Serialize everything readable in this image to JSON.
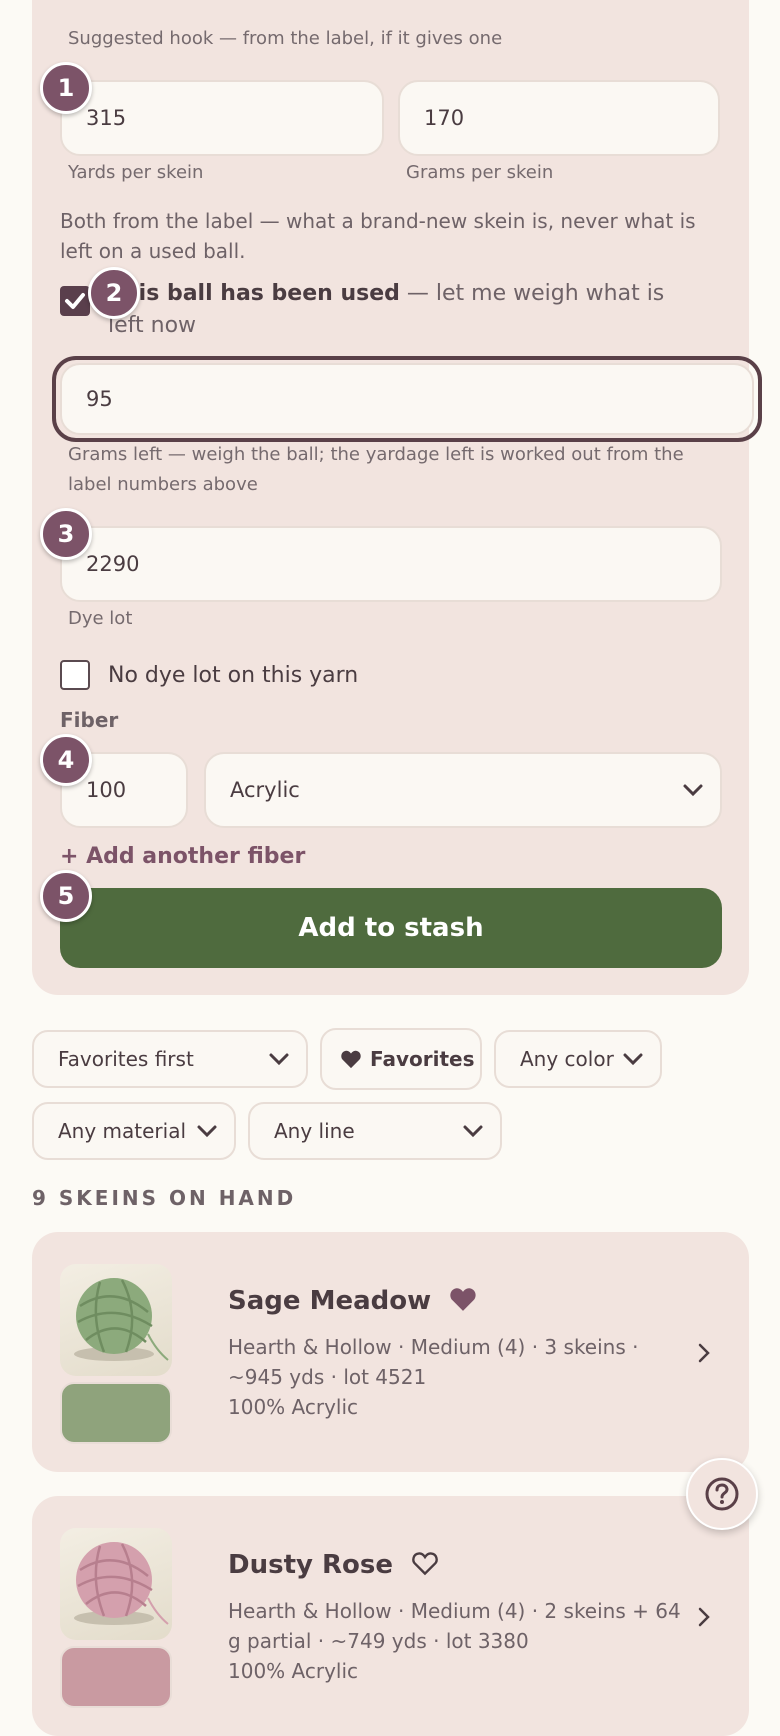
{
  "form": {
    "hook_help": "Suggested hook — from the label, if it gives one",
    "yards": {
      "value": "315",
      "label": "Yards per skein"
    },
    "grams": {
      "value": "170",
      "label": "Grams per skein"
    },
    "label_note": "Both from the label — what a brand-new skein is, never what is left on a used ball.",
    "used_checkbox": {
      "checked": true,
      "label_bold": "This ball has been used",
      "label_rest": " — let me weigh what is left now"
    },
    "grams_left": {
      "value": "95",
      "help": "Grams left — weigh the ball; the yardage left is worked out from the label numbers above"
    },
    "dye_lot": {
      "value": "2290",
      "label": "Dye lot"
    },
    "no_dye_lot": {
      "checked": false,
      "label": "No dye lot on this yarn"
    },
    "fiber": {
      "heading": "Fiber",
      "percent": "100",
      "material": "Acrylic",
      "add_label": "+ Add another fiber"
    },
    "submit_label": "Add to stash"
  },
  "badges": [
    "1",
    "2",
    "3",
    "4",
    "5"
  ],
  "filters": {
    "sort": "Favorites first",
    "favorites": "Favorites",
    "color": "Any color",
    "material": "Any material",
    "line": "Any line"
  },
  "list_heading": "9 SKEINS ON HAND",
  "yarns": [
    {
      "name": "Sage Meadow",
      "favorite": true,
      "meta": "Hearth & Hollow · Medium (4) · 3 skeins · ~945 yds · lot 4521",
      "fiber": "100% Acrylic",
      "swatch_color": "#8fa37c",
      "ball_color": "#8caa7c"
    },
    {
      "name": "Dusty Rose",
      "favorite": false,
      "meta": "Hearth & Hollow · Medium (4) · 2 skeins + 64 g partial · ~749 yds · lot 3380",
      "fiber": "100% Acrylic",
      "swatch_color": "#c99aa1",
      "ball_color": "#d4a0ad"
    }
  ],
  "colors": {
    "accent": "#7c5368",
    "submit": "#4f6b3e",
    "card": "#f2e4df",
    "page": "#fcfaf5"
  },
  "icons": {
    "help": "help-icon",
    "heart_filled": "heart-filled-icon",
    "heart_outline": "heart-outline-icon",
    "chevron": "chevron-right-icon"
  }
}
